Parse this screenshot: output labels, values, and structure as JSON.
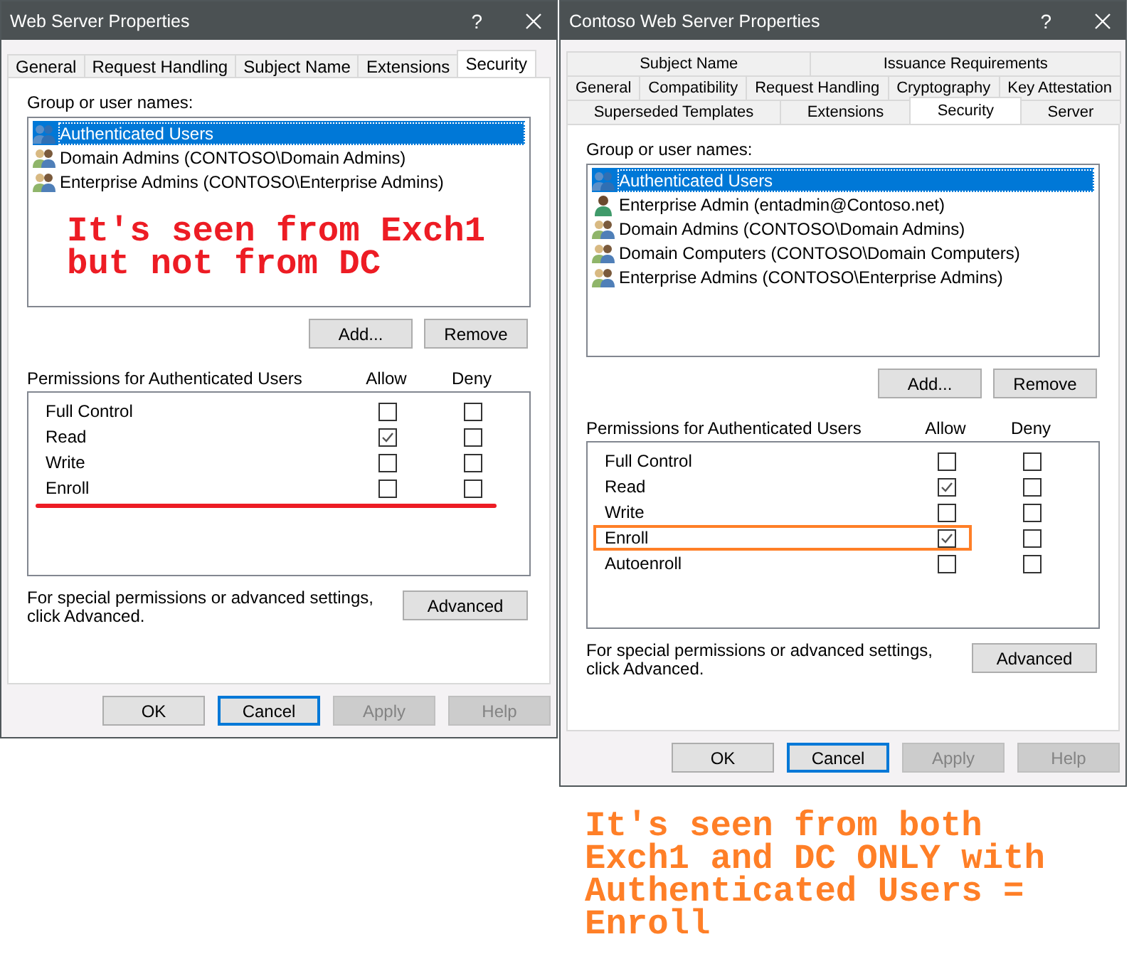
{
  "dialogs": [
    {
      "title": "Web Server Properties",
      "help": "?",
      "tab_rows": [
        [
          {
            "label": "General",
            "selected": false
          },
          {
            "label": "Request Handling",
            "selected": false
          },
          {
            "label": "Subject Name",
            "selected": false
          },
          {
            "label": "Extensions",
            "selected": false
          },
          {
            "label": "Security",
            "selected": true
          }
        ]
      ],
      "group_label": "Group or user names:",
      "principals": [
        {
          "name": "Authenticated Users",
          "kind": "group",
          "selected": true
        },
        {
          "name": "Domain Admins (CONTOSO\\Domain Admins)",
          "kind": "admins",
          "selected": false
        },
        {
          "name": "Enterprise Admins (CONTOSO\\Enterprise Admins)",
          "kind": "admins",
          "selected": false
        }
      ],
      "list_note": "It's seen from Exch1 but not from DC",
      "add_button": "Add...",
      "remove_button": "Remove",
      "permissions_label": "Permissions for Authenticated Users",
      "allow_label": "Allow",
      "deny_label": "Deny",
      "permissions": [
        {
          "name": "Full Control",
          "allow": false,
          "deny": false,
          "underlined": false,
          "boxed": false
        },
        {
          "name": "Read",
          "allow": true,
          "deny": false,
          "underlined": false,
          "boxed": false
        },
        {
          "name": "Write",
          "allow": false,
          "deny": false,
          "underlined": false,
          "boxed": false
        },
        {
          "name": "Enroll",
          "allow": false,
          "deny": false,
          "underlined": true,
          "boxed": false
        }
      ],
      "advanced_text": "For special permissions or advanced settings, click Advanced.",
      "advanced_button": "Advanced",
      "buttons": [
        {
          "label": "OK",
          "default": false,
          "disabled": false
        },
        {
          "label": "Cancel",
          "default": true,
          "disabled": false
        },
        {
          "label": "Apply",
          "default": false,
          "disabled": true
        },
        {
          "label": "Help",
          "default": false,
          "disabled": true
        }
      ]
    },
    {
      "title": "Contoso Web Server Properties",
      "help": "?",
      "tab_rows": [
        [
          {
            "label": "Subject Name",
            "selected": false
          },
          {
            "label": "Issuance Requirements",
            "selected": false
          }
        ],
        [
          {
            "label": "General",
            "selected": false
          },
          {
            "label": "Compatibility",
            "selected": false
          },
          {
            "label": "Request Handling",
            "selected": false
          },
          {
            "label": "Cryptography",
            "selected": false
          },
          {
            "label": "Key Attestation",
            "selected": false
          }
        ],
        [
          {
            "label": "Superseded Templates",
            "selected": false
          },
          {
            "label": "Extensions",
            "selected": false
          },
          {
            "label": "Security",
            "selected": true
          },
          {
            "label": "Server",
            "selected": false
          }
        ]
      ],
      "group_label": "Group or user names:",
      "principals": [
        {
          "name": "Authenticated Users",
          "kind": "group",
          "selected": true
        },
        {
          "name": "Enterprise Admin (entadmin@Contoso.net)",
          "kind": "user",
          "selected": false
        },
        {
          "name": "Domain Admins (CONTOSO\\Domain Admins)",
          "kind": "admins",
          "selected": false
        },
        {
          "name": "Domain Computers (CONTOSO\\Domain Computers)",
          "kind": "admins",
          "selected": false
        },
        {
          "name": "Enterprise Admins (CONTOSO\\Enterprise Admins)",
          "kind": "admins",
          "selected": false
        }
      ],
      "add_button": "Add...",
      "remove_button": "Remove",
      "permissions_label": "Permissions for Authenticated Users",
      "allow_label": "Allow",
      "deny_label": "Deny",
      "permissions": [
        {
          "name": "Full Control",
          "allow": false,
          "deny": false,
          "underlined": false,
          "boxed": false
        },
        {
          "name": "Read",
          "allow": true,
          "deny": false,
          "underlined": false,
          "boxed": false
        },
        {
          "name": "Write",
          "allow": false,
          "deny": false,
          "underlined": false,
          "boxed": false
        },
        {
          "name": "Enroll",
          "allow": true,
          "deny": false,
          "underlined": false,
          "boxed": true
        },
        {
          "name": "Autoenroll",
          "allow": false,
          "deny": false,
          "underlined": false,
          "boxed": false
        }
      ],
      "advanced_text": "For special permissions or advanced settings, click Advanced.",
      "advanced_button": "Advanced",
      "buttons": [
        {
          "label": "OK",
          "default": false,
          "disabled": false
        },
        {
          "label": "Cancel",
          "default": true,
          "disabled": false
        },
        {
          "label": "Apply",
          "default": false,
          "disabled": true
        },
        {
          "label": "Help",
          "default": false,
          "disabled": true
        }
      ],
      "caption": "It's seen from both Exch1 and DC ONLY with Authenticated Users = Enroll"
    }
  ]
}
